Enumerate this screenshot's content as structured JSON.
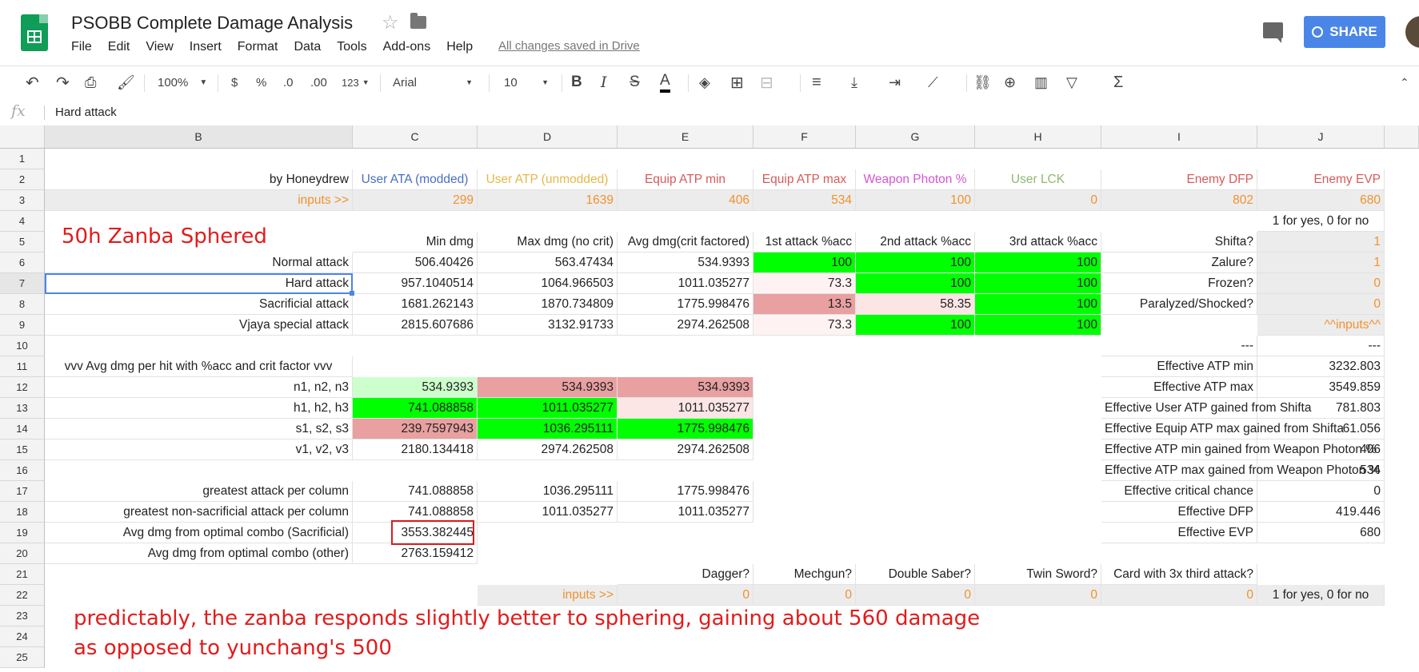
{
  "doc": {
    "title": "PSOBB Complete Damage Analysis",
    "saved_status": "All changes saved in Drive",
    "menu": [
      "File",
      "Edit",
      "View",
      "Insert",
      "Format",
      "Data",
      "Tools",
      "Add-ons",
      "Help"
    ],
    "share_label": "SHARE"
  },
  "toolbar": {
    "zoom": "100%",
    "currency": "$",
    "percent": "%",
    "dec_less": ".0",
    "dec_more": ".00",
    "more_formats": "123",
    "font": "Arial",
    "font_size": "10"
  },
  "formula_bar": {
    "fx": "fx",
    "value": "Hard attack"
  },
  "columns": [
    "B",
    "C",
    "D",
    "E",
    "F",
    "G",
    "H",
    "I",
    "J"
  ],
  "rows": [
    "1",
    "2",
    "3",
    "4",
    "5",
    "6",
    "7",
    "8",
    "9",
    "10",
    "11",
    "12",
    "13",
    "14",
    "15",
    "16",
    "17",
    "18",
    "19",
    "20",
    "21",
    "22",
    "23",
    "24",
    "25"
  ],
  "colors": {
    "blue": "#4a6fc4",
    "yellow": "#e6b84a",
    "salmon": "#d85a5a",
    "pink": "#d655d6",
    "green_text": "#8fb871",
    "orange": "#f0922e",
    "bright_green": "#00ff00",
    "light_green": "#ccffcc",
    "red_fill": "#e8a0a0",
    "light_red": "#fbe5e5",
    "pale_red": "#fff2f2",
    "input_gray": "#ececec",
    "annotation_red": "#e31b1b"
  },
  "cells": {
    "B2": "by Honeydrew",
    "C2": "User ATA (modded)",
    "D2": "User ATP (unmodded)",
    "E2": "Equip ATP min",
    "F2": "Equip ATP max",
    "G2": "Weapon Photon %",
    "H2": "User LCK",
    "I2": "Enemy DFP",
    "J2": "Enemy EVP",
    "B3": "inputs >>",
    "C3": "299",
    "D3": "1639",
    "E3": "406",
    "F3": "534",
    "G3": "100",
    "H3": "0",
    "I3": "802",
    "J3": "680",
    "J4": "1 for yes, 0 for no",
    "C5": "Min dmg",
    "D5": "Max dmg (no crit)",
    "E5": "Avg dmg(crit factored)",
    "F5": "1st attack %acc",
    "G5": "2nd attack %acc",
    "H5": "3rd attack %acc",
    "I5": "Shifta?",
    "J5": "1",
    "B6": "Normal attack",
    "C6": "506.40426",
    "D6": "563.47434",
    "E6": "534.9393",
    "F6": "100",
    "G6": "100",
    "H6": "100",
    "I6": "Zalure?",
    "J6": "1",
    "B7": "Hard attack",
    "C7": "957.1040514",
    "D7": "1064.966503",
    "E7": "1011.035277",
    "F7": "73.3",
    "G7": "100",
    "H7": "100",
    "I7": "Frozen?",
    "J7": "0",
    "B8": "Sacrificial attack",
    "C8": "1681.262143",
    "D8": "1870.734809",
    "E8": "1775.998476",
    "F8": "13.5",
    "G8": "58.35",
    "H8": "100",
    "I8": "Paralyzed/Shocked?",
    "J8": "0",
    "B9": "Vjaya special attack",
    "C9": "2815.607686",
    "D9": "3132.91733",
    "E9": "2974.262508",
    "F9": "73.3",
    "G9": "100",
    "H9": "100",
    "J9": "^^inputs^^",
    "I10": "---",
    "J10": "---",
    "B11": "vvv Avg dmg per hit with %acc and crit factor vvv",
    "I11": "Effective ATP min",
    "J11": "3232.803",
    "B12": "n1, n2, n3",
    "C12": "534.9393",
    "D12": "534.9393",
    "E12": "534.9393",
    "I12": "Effective ATP max",
    "J12": "3549.859",
    "B13": "h1, h2, h3",
    "C13": "741.088858",
    "D13": "1011.035277",
    "E13": "1011.035277",
    "I13": "Effective User ATP gained from Shifta",
    "J13": "781.803",
    "B14": "s1, s2, s3",
    "C14": "239.7597943",
    "D14": "1036.295111",
    "E14": "1775.998476",
    "I14": "Effective Equip ATP max gained from Shifta",
    "J14": "61.056",
    "B15": "v1, v2, v3",
    "C15": "2180.134418",
    "D15": "2974.262508",
    "E15": "2974.262508",
    "I15": "Effective ATP min gained from Weapon Photon %",
    "J15": "406",
    "I16": "Effective ATP max gained from Weapon Photon %",
    "J16": "534",
    "B17": "greatest attack per column",
    "C17": "741.088858",
    "D17": "1036.295111",
    "E17": "1775.998476",
    "I17": "Effective critical chance",
    "J17": "0",
    "B18": "greatest non-sacrificial attack per column",
    "C18": "741.088858",
    "D18": "1011.035277",
    "E18": "1011.035277",
    "I18": "Effective DFP",
    "J18": "419.446",
    "B19": "Avg dmg from optimal combo (Sacrificial)",
    "C19": "3553.382445",
    "I19": "Effective EVP",
    "J19": "680",
    "B20": "Avg dmg from optimal combo (other)",
    "C20": "2763.159412",
    "E21": "Dagger?",
    "F21": "Mechgun?",
    "G21": "Double Saber?",
    "H21": "Twin Sword?",
    "I21": "Card with 3x third attack?",
    "D22": "inputs >>",
    "E22": "0",
    "F22": "0",
    "G22": "0",
    "H22": "0",
    "I22": "0",
    "J22": "1 for yes, 0 for no"
  },
  "annotations": {
    "weapon": "50h Zanba Sphered",
    "comment_line1": "predictably, the zanba responds slightly better to sphering, gaining about 560 damage",
    "comment_line2": "as opposed to yunchang's 500"
  }
}
